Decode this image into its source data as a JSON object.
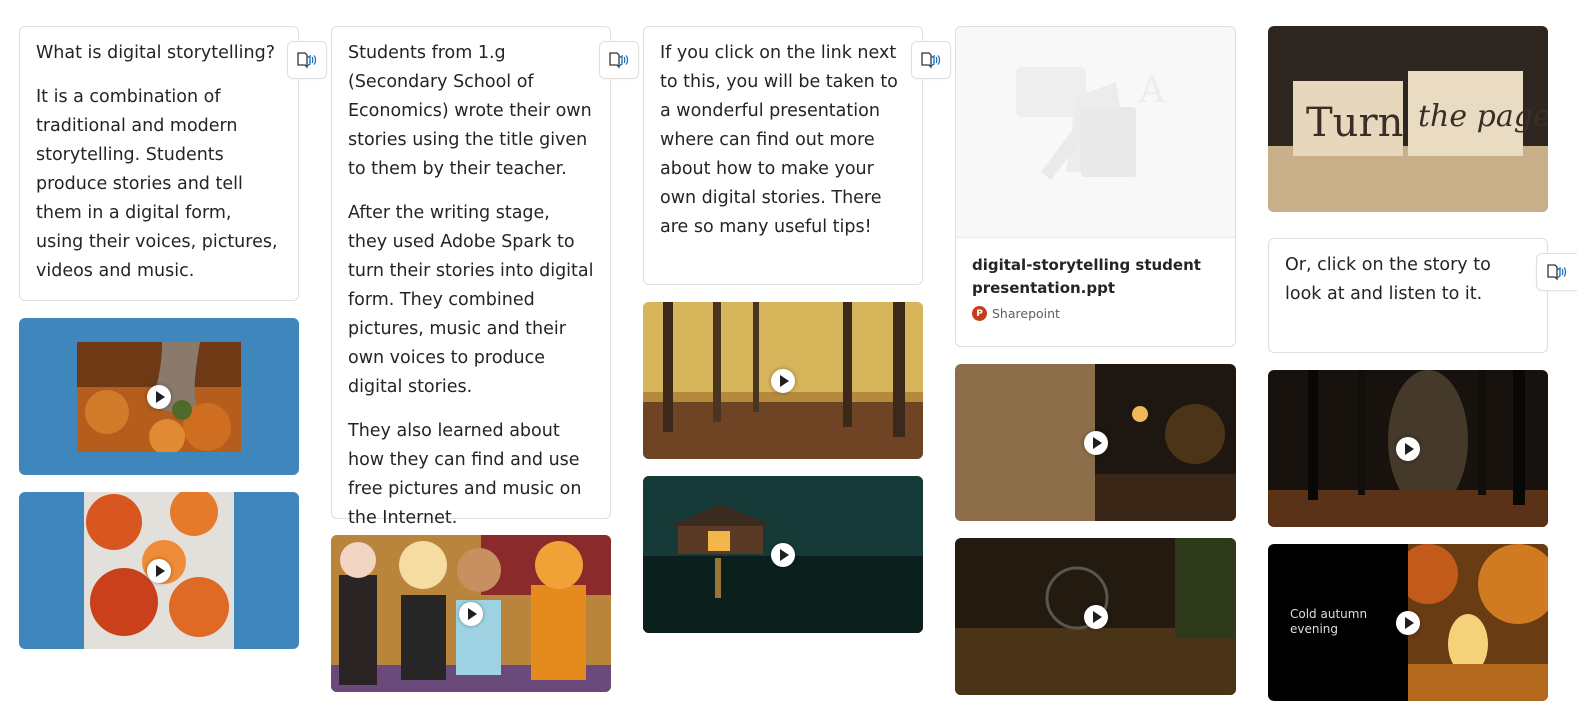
{
  "column1": {
    "heading": "What is digital storytelling?",
    "body": "It is a combination of traditional and modern storytelling. Students produce stories and tell them in a digital form, using their voices, pictures, videos and music."
  },
  "column2": {
    "p1": "Students from 1.g (Secondary School of Economics) wrote their own stories using the title given to them by their teacher.",
    "p2": "After the writing stage, they used Adobe Spark to turn their stories into digital form. They combined pictures, music and their own voices to produce digital stories.",
    "p3": "They also learned about how they can find and use free pictures and music on the Internet."
  },
  "column3": {
    "body": "If you click on the link next to this, you will be taken to a wonderful presentation where can find out more about how to make your own digital stories. There are so many useful tips!"
  },
  "column4": {
    "file_title": "digital-storytelling student presentation.ppt",
    "file_source": "Sharepoint",
    "file_icon_letter": "P"
  },
  "column5": {
    "cover_text_left": "Turn",
    "cover_text_right": "the page",
    "body": "Or, click on the story to look at and listen to it.",
    "video_caption": "Cold autumn evening"
  },
  "colors": {
    "video_bg_blue": "#3f86bd",
    "card_border": "#e1dfdd",
    "reader_blue": "#0f6cbd",
    "tan_panel": "#8d6e4a"
  }
}
